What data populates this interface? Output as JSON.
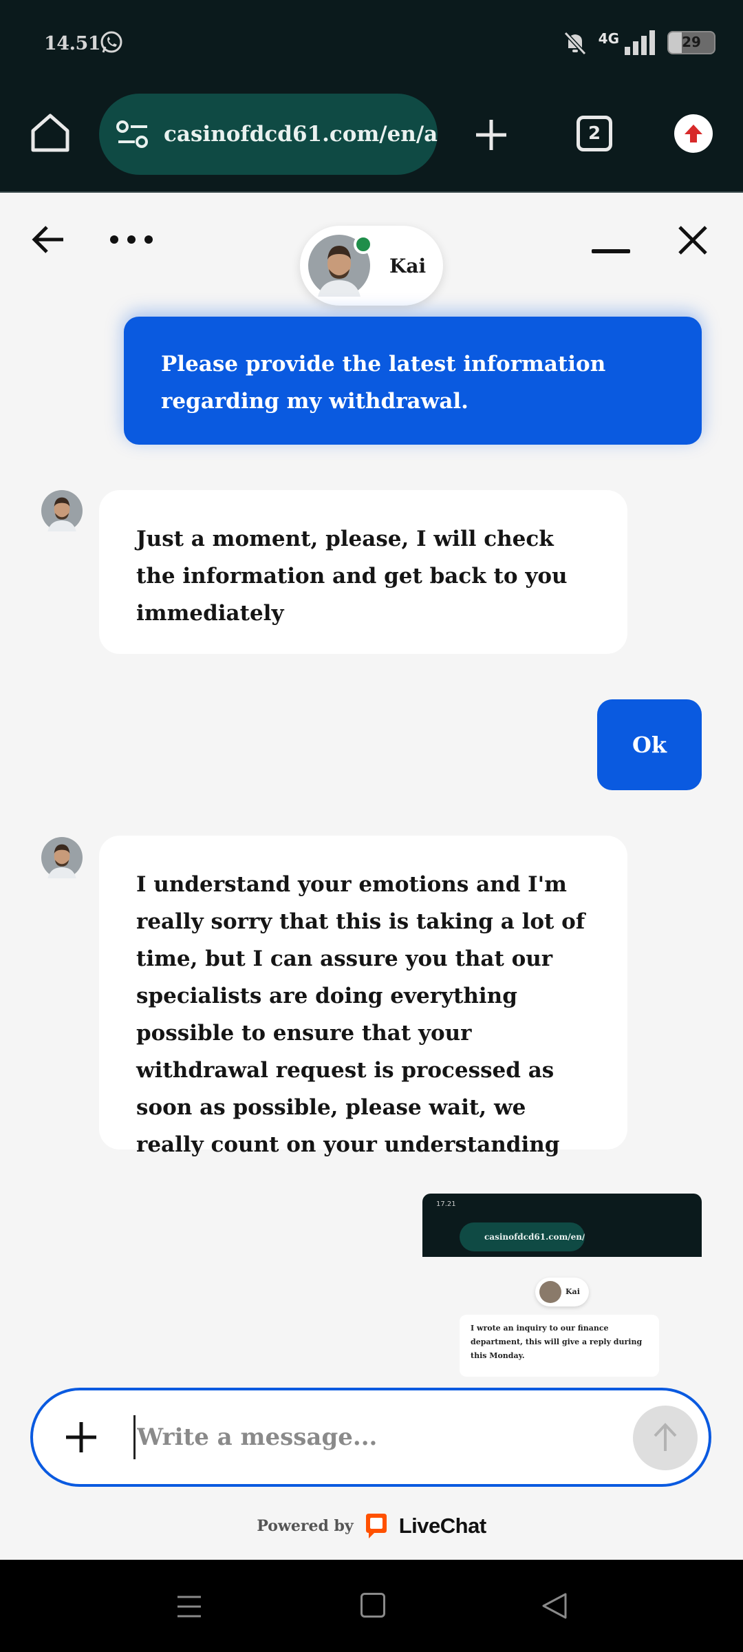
{
  "status_bar": {
    "time": "14.51",
    "network": "4G",
    "battery": "29"
  },
  "browser": {
    "url": "casinofdcd61.com/en/a",
    "tab_count": "2"
  },
  "chat": {
    "agent_name": "Kai",
    "agent_status_color": "#1f8e4a",
    "messages": [
      {
        "from": "visitor",
        "text": "Please provide the latest information regarding my withdrawal."
      },
      {
        "from": "agent",
        "text": "Just a moment, please, I will check the information and get back to you immediately"
      },
      {
        "from": "visitor",
        "text": "Ok"
      },
      {
        "from": "agent",
        "text": "I understand your emotions and I'm really sorry that this is taking a lot of time, but I can assure you that our specialists are doing everything possible to ensure that your withdrawal request is processed as soon as possible, please wait, we really count on your understanding"
      }
    ],
    "attachment": {
      "time": "17.21",
      "url": "casinofdcd61.com/en/a",
      "agent_name": "Kai",
      "message": "I wrote an inquiry to our finance department, this will give a reply during this Monday."
    }
  },
  "composer": {
    "placeholder": "Write a message..."
  },
  "footer": {
    "powered_by": "Powered by",
    "brand": "LiveChat",
    "brand_color": "#ff5100"
  },
  "colors": {
    "visitor_bubble": "#0a5ae0",
    "agent_bubble": "#ffffff",
    "browser_bar": "#0b1a1c",
    "url_pill": "#0f4a44"
  }
}
